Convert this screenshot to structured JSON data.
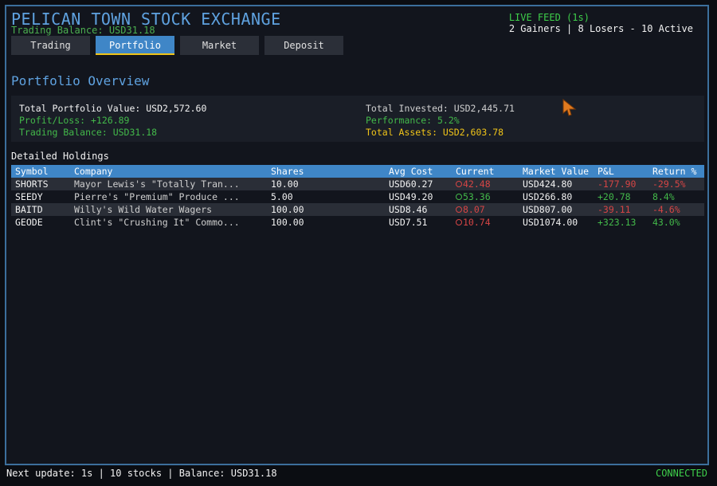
{
  "app": {
    "title": "PELICAN TOWN STOCK EXCHANGE",
    "balance": "Trading Balance: USD31.18"
  },
  "live": {
    "feed": "LIVE FEED (1s)",
    "counts": "2 Gainers | 8 Losers - 10 Active"
  },
  "tabs": [
    "Trading",
    "Portfolio",
    "Market",
    "Deposit"
  ],
  "active_tab": "Portfolio",
  "overview": {
    "title": "Portfolio Overview",
    "total_value": "Total Portfolio Value: USD2,572.60",
    "profit_loss": "Profit/Loss: +126.89",
    "trading_balance": "Trading Balance: USD31.18",
    "total_invested": "Total Invested: USD2,445.71",
    "performance": "Performance: 5.2%",
    "total_assets": "Total Assets: USD2,603.78"
  },
  "holdings": {
    "title": "Detailed Holdings",
    "headers": [
      "Symbol",
      "Company",
      "Shares",
      "Avg Cost",
      "Current",
      "Market Value",
      "P&L",
      "Return %"
    ],
    "rows": [
      {
        "symbol": "SHORTS",
        "company": "Mayor Lewis's \"Totally Tran...",
        "shares": "10.00",
        "avg_cost": "USD60.27",
        "current": "42.48",
        "market_value": "USD424.80",
        "pnl": "-177.90",
        "ret": "-29.5%",
        "trend": "down"
      },
      {
        "symbol": "SEEDY",
        "company": "Pierre's \"Premium\" Produce ...",
        "shares": "5.00",
        "avg_cost": "USD49.20",
        "current": "53.36",
        "market_value": "USD266.80",
        "pnl": "+20.78",
        "ret": "8.4%",
        "trend": "up"
      },
      {
        "symbol": "BAITD",
        "company": "Willy's Wild Water Wagers",
        "shares": "100.00",
        "avg_cost": "USD8.46",
        "current": "8.07",
        "market_value": "USD807.00",
        "pnl": "-39.11",
        "ret": "-4.6%",
        "trend": "down"
      },
      {
        "symbol": "GEODE",
        "company": "Clint's \"Crushing It\" Commo...",
        "shares": "100.00",
        "avg_cost": "USD7.51",
        "current": "10.74",
        "market_value": "USD1074.00",
        "pnl": "+323.13",
        "ret": "43.0%",
        "trend": "down"
      }
    ]
  },
  "footer": {
    "status": "Next update: 1s | 10 stocks | Balance: USD31.18",
    "connection": "CONNECTED"
  },
  "colors": {
    "accent": "#3f86c7",
    "gain": "#43b94a",
    "loss": "#d64545",
    "highlight": "#f0c419"
  }
}
